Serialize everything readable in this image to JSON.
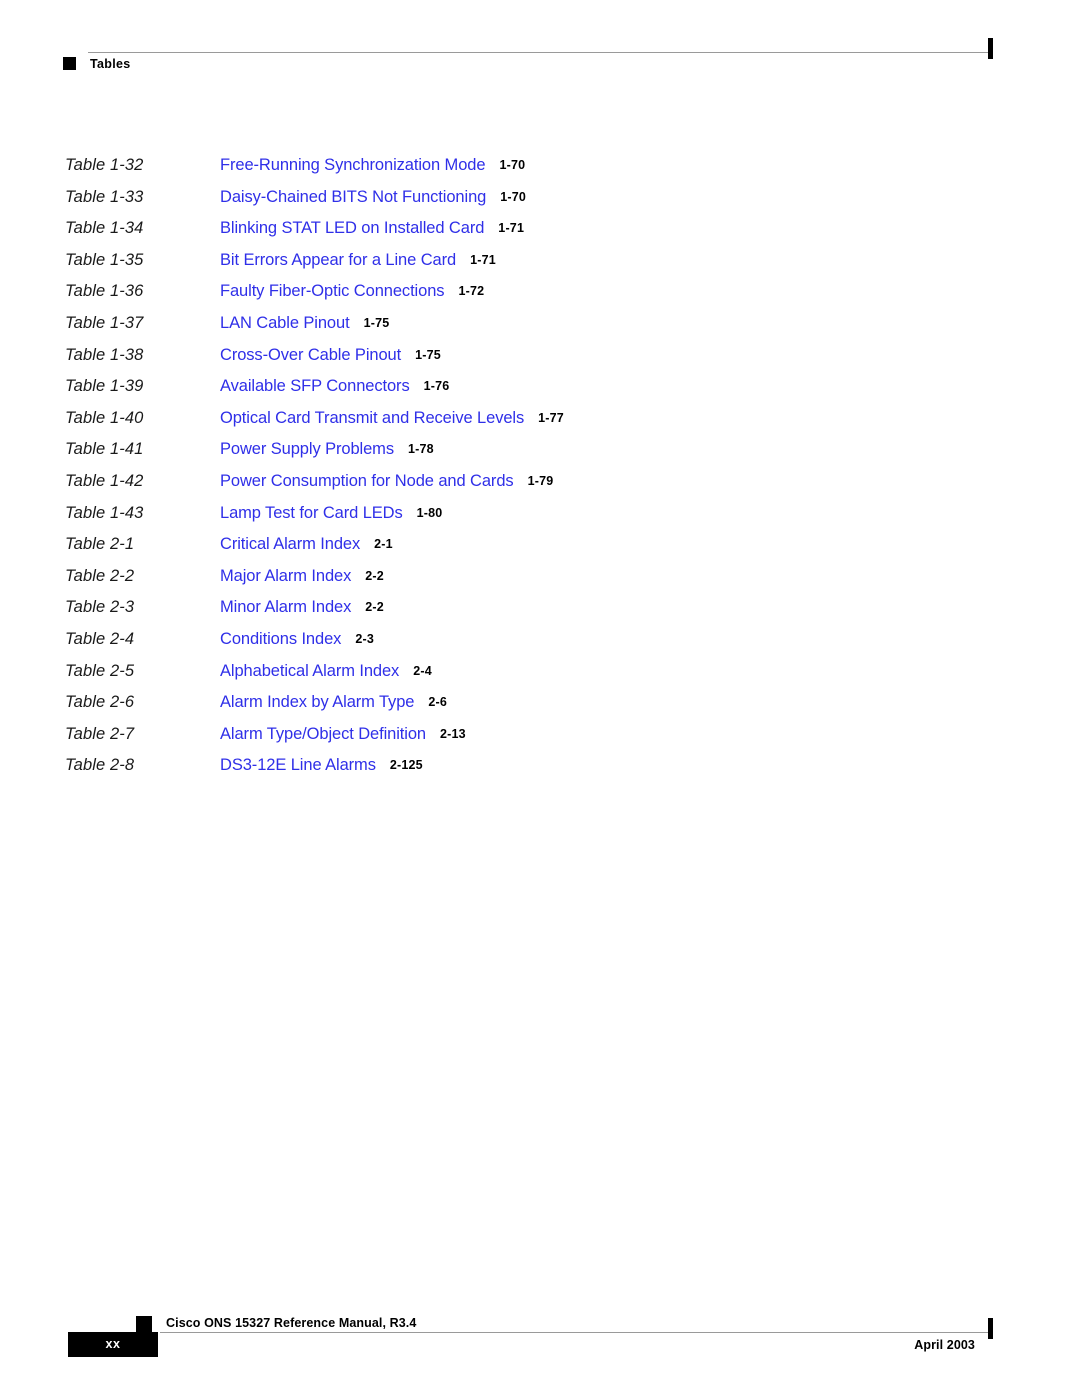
{
  "header": {
    "section_label": "Tables"
  },
  "list_of_tables": {
    "entries": [
      {
        "label": "Table 1-32",
        "title": "Free-Running Synchronization Mode",
        "page": "1-70"
      },
      {
        "label": "Table 1-33",
        "title": "Daisy-Chained BITS Not Functioning",
        "page": "1-70"
      },
      {
        "label": "Table 1-34",
        "title": "Blinking STAT LED on Installed Card",
        "page": "1-71"
      },
      {
        "label": "Table 1-35",
        "title": "Bit Errors Appear for a Line Card",
        "page": "1-71"
      },
      {
        "label": "Table 1-36",
        "title": "Faulty Fiber-Optic Connections",
        "page": "1-72"
      },
      {
        "label": "Table 1-37",
        "title": "LAN Cable Pinout",
        "page": "1-75"
      },
      {
        "label": "Table 1-38",
        "title": "Cross-Over Cable Pinout",
        "page": "1-75"
      },
      {
        "label": "Table 1-39",
        "title": "Available SFP Connectors",
        "page": "1-76"
      },
      {
        "label": "Table 1-40",
        "title": "Optical Card Transmit and Receive Levels",
        "page": "1-77"
      },
      {
        "label": "Table 1-41",
        "title": "Power Supply Problems",
        "page": "1-78"
      },
      {
        "label": "Table 1-42",
        "title": "Power Consumption for Node and Cards",
        "page": "1-79"
      },
      {
        "label": "Table 1-43",
        "title": "Lamp Test for Card LEDs",
        "page": "1-80"
      },
      {
        "label": "Table 2-1",
        "title": "Critical Alarm Index",
        "page": "2-1"
      },
      {
        "label": "Table 2-2",
        "title": "Major Alarm Index",
        "page": "2-2"
      },
      {
        "label": "Table 2-3",
        "title": "Minor Alarm Index",
        "page": "2-2"
      },
      {
        "label": "Table 2-4",
        "title": "Conditions Index",
        "page": "2-3"
      },
      {
        "label": "Table 2-5",
        "title": "Alphabetical Alarm Index",
        "page": "2-4"
      },
      {
        "label": "Table 2-6",
        "title": "Alarm Index by Alarm Type",
        "page": "2-6"
      },
      {
        "label": "Table 2-7",
        "title": "Alarm Type/Object Definition",
        "page": "2-13"
      },
      {
        "label": "Table 2-8",
        "title": "DS3-12E Line Alarms",
        "page": "2-125"
      }
    ]
  },
  "footer": {
    "page_number": "xx",
    "document_name": "Cisco ONS 15327 Reference Manual, R3.4",
    "date": "April 2003"
  },
  "colors": {
    "link_blue": "#2f2fe8",
    "rule_gray": "#9a9a9a",
    "text_black": "#000000"
  }
}
